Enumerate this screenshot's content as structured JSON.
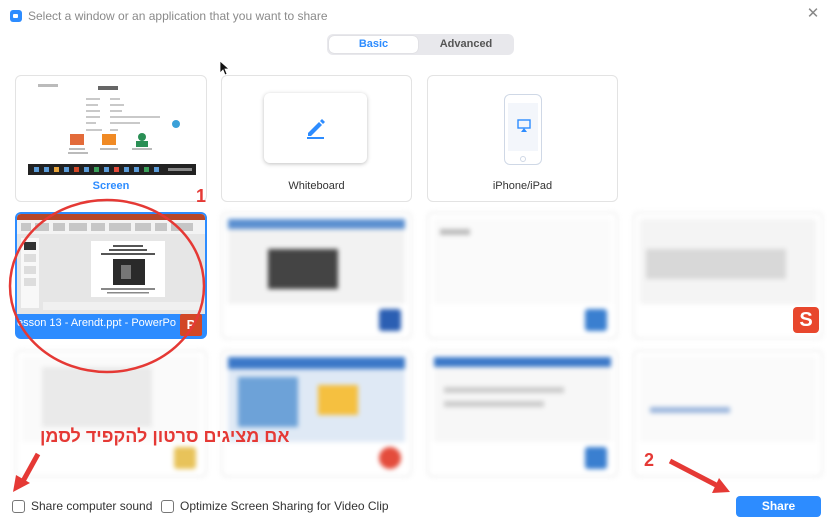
{
  "window": {
    "title": "Select a window or an application that you want to share",
    "close_glyph": "✕"
  },
  "tabs": [
    {
      "label": "Basic",
      "selected": true
    },
    {
      "label": "Advanced",
      "selected": false
    }
  ],
  "cards": {
    "screen": {
      "label": "Screen",
      "icon": "desktop-thumbnail"
    },
    "whiteboard": {
      "label": "Whiteboard",
      "icon": "pencil-icon"
    },
    "iphone": {
      "label": "iPhone/iPad",
      "icon": "airplay-icon"
    },
    "powerpoint": {
      "label": "esson 13 - Arendt.ppt - PowerPo...",
      "icon": "powerpoint-icon",
      "icon_glyph": "P",
      "selected": true
    }
  },
  "snagit": {
    "glyph": "S"
  },
  "annotations": {
    "marker_one": "1",
    "marker_two": "2",
    "hebrew_note": "אם מציגים סרטון להקפיד לסמן"
  },
  "footer": {
    "share_sound_label": "Share computer sound",
    "share_sound_checked": false,
    "optimize_label": "Optimize Screen Sharing for Video Clip",
    "optimize_checked": false,
    "share_button": "Share"
  },
  "colors": {
    "accent": "#2d8cff",
    "annotation": "#e53935",
    "powerpoint": "#d24726"
  }
}
